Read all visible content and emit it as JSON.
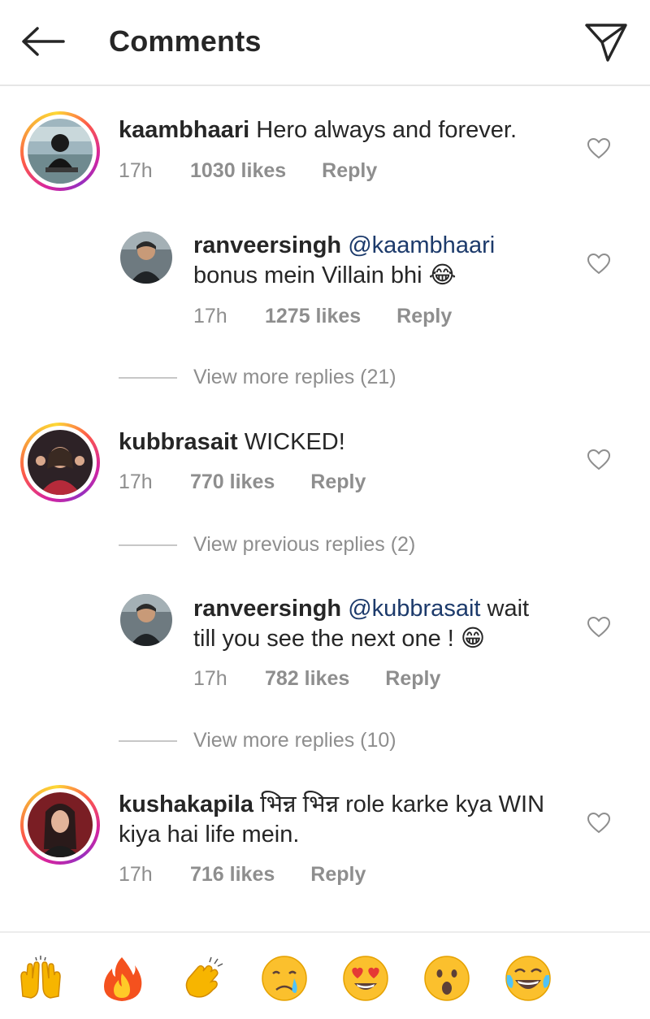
{
  "header": {
    "title": "Comments",
    "back_icon": "arrow-left-icon",
    "send_icon": "paper-plane-icon"
  },
  "comments": [
    {
      "username": "kaambhaari",
      "text": "Hero always and forever.",
      "time": "17h",
      "likes": "1030 likes",
      "reply": "Reply"
    },
    {
      "username": "ranveersingh",
      "mention": "@kaambhaari",
      "text": "bonus mein Villain bhi",
      "emoji": "😂",
      "time": "17h",
      "likes": "1275 likes",
      "reply": "Reply"
    },
    {
      "username": "kubbrasait",
      "text": "WICKED!",
      "time": "17h",
      "likes": "770 likes",
      "reply": "Reply"
    },
    {
      "username": "ranveersingh",
      "mention": "@kubbrasait",
      "text_line1": "wait",
      "text_line2": "till you see the next one !",
      "emoji": "😁",
      "time": "17h",
      "likes": "782 likes",
      "reply": "Reply"
    },
    {
      "username": "kushakapila",
      "text_line1": "भिन्न भिन्न role karke kya WIN",
      "text_line2": "kiya hai life mein.",
      "time": "17h",
      "likes": "716 likes",
      "reply": "Reply"
    }
  ],
  "view_replies": [
    "View more replies (21)",
    "View previous replies (2)",
    "View more replies (10)"
  ],
  "emoji_bar": [
    "raising-hands-icon",
    "fire-icon",
    "clapping-hands-icon",
    "crying-face-icon",
    "heart-eyes-icon",
    "surprised-face-icon",
    "tears-of-joy-icon"
  ]
}
